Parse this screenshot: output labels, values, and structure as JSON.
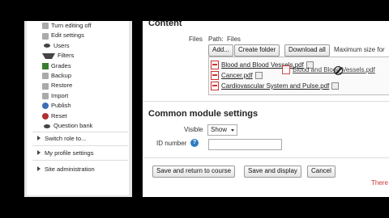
{
  "sidebar": {
    "items": [
      {
        "label": "Turn editing off",
        "icon": "edit-icon"
      },
      {
        "label": "Edit settings",
        "icon": "settings-icon"
      },
      {
        "label": "Users",
        "icon": "users-icon"
      },
      {
        "label": "Filters",
        "icon": "funnel-icon"
      },
      {
        "label": "Grades",
        "icon": "grades-icon"
      },
      {
        "label": "Backup",
        "icon": "backup-icon"
      },
      {
        "label": "Restore",
        "icon": "restore-icon"
      },
      {
        "label": "Import",
        "icon": "import-icon"
      },
      {
        "label": "Publish",
        "icon": "publish-icon"
      },
      {
        "label": "Reset",
        "icon": "reset-icon"
      },
      {
        "label": "Question bank",
        "icon": "bullet-icon"
      }
    ],
    "links": {
      "switch_role": "Switch role to...",
      "my_profile": "My profile settings",
      "site_admin": "Site administration"
    }
  },
  "content": {
    "title": "Content",
    "files_label": "Files",
    "path_label": "Path:",
    "path_value": "Files",
    "buttons": {
      "add": "Add...",
      "create_folder": "Create folder",
      "download_all": "Download all"
    },
    "max_size": "Maximum size for",
    "files": [
      "Blood and Blood Vessels.pdf",
      "Cancer.pdf",
      "Cardiovascular System and Pulse.pdf"
    ],
    "drag_label": "Blood and Blood Vessels.pdf"
  },
  "common": {
    "title": "Common module settings",
    "visible_label": "Visible",
    "visible_value": "Show",
    "id_label": "ID number",
    "help_glyph": "?"
  },
  "actions": {
    "save_return": "Save and return to course",
    "save_display": "Save and display",
    "cancel": "Cancel",
    "required_note": "There"
  },
  "colors": {
    "link_red": "#cc3333",
    "help_blue": "#2f7cc0"
  }
}
